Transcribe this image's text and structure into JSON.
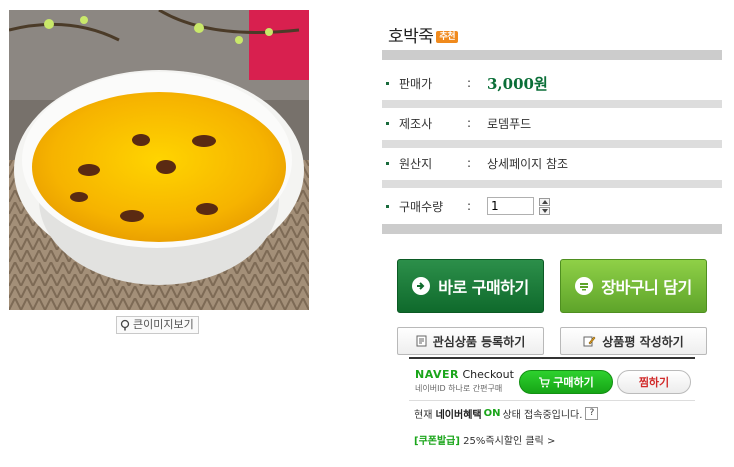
{
  "product": {
    "image_alt": "pumpkin porridge in white bowl",
    "zoom_label": "큰이미지보기",
    "name": "호박죽",
    "badge": "추천"
  },
  "details": [
    {
      "label": "판매가",
      "value": "3,000원"
    },
    {
      "label": "제조사",
      "value": "로뎀푸드"
    },
    {
      "label": "원산지",
      "value": "상세페이지 참조"
    },
    {
      "label": "구매수량",
      "value": "1"
    }
  ],
  "colon": ":",
  "buttons": {
    "buy_now": "바로 구매하기",
    "add_cart": "장바구니 담기",
    "wishlist": "관심상품 등록하기",
    "review": "상품평 작성하기"
  },
  "naver": {
    "brand": "NAVER",
    "checkout": "Checkout",
    "sub": "네이버ID 하나로 간편구매",
    "buy": "구매하기",
    "zzim": "찜하기",
    "status_prefix": "현재",
    "status_brand": "네이버혜택",
    "status_on": "ON",
    "status_suffix": "상태 접속중입니다.",
    "help": "?"
  },
  "coupon": {
    "tag": "[쿠폰발급]",
    "text": "25%즉시할인 클릭",
    "arrow": ">"
  },
  "colors": {
    "price": "#0a6e37",
    "buy_button": "#0f6a2c",
    "cart_button": "#5ea42a",
    "naver_green": "#1aa51a",
    "badge": "#f08a1d"
  }
}
